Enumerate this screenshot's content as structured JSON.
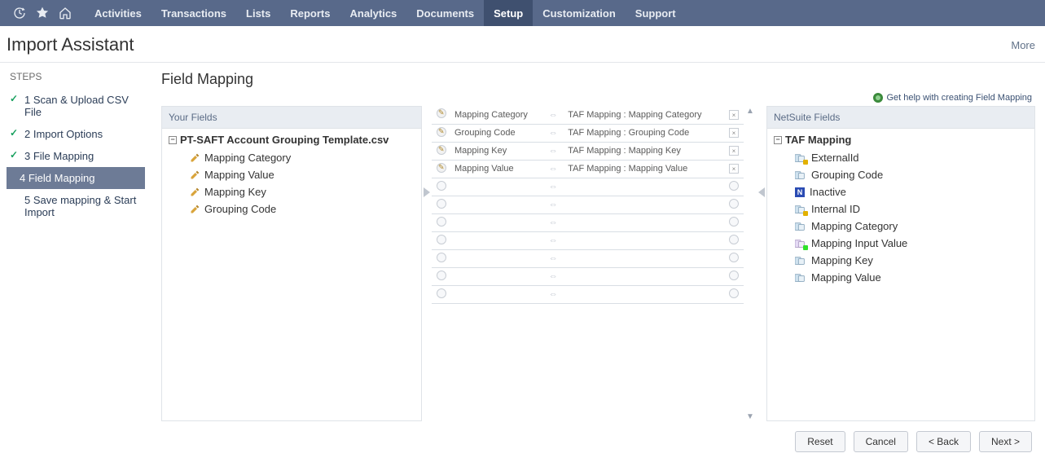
{
  "topnav": {
    "items": [
      "Activities",
      "Transactions",
      "Lists",
      "Reports",
      "Analytics",
      "Documents",
      "Setup",
      "Customization",
      "Support"
    ],
    "active_index": 6
  },
  "page": {
    "title": "Import Assistant",
    "more": "More"
  },
  "steps": {
    "title": "STEPS",
    "items": [
      {
        "num": "1",
        "label": "Scan & Upload CSV File",
        "done": true
      },
      {
        "num": "2",
        "label": "Import Options",
        "done": true
      },
      {
        "num": "3",
        "label": "File Mapping",
        "done": true
      },
      {
        "num": "4",
        "label": "Field Mapping",
        "active": true
      },
      {
        "num": "5",
        "label": "Save mapping & Start Import"
      }
    ]
  },
  "main": {
    "section_title": "Field Mapping",
    "help_text": "Get help with creating Field Mapping",
    "your_fields": {
      "header": "Your Fields",
      "root": "PT-SAFT Account Grouping Template.csv",
      "children": [
        "Mapping Category",
        "Mapping Value",
        "Mapping Key",
        "Grouping Code"
      ]
    },
    "mappings": [
      {
        "left": "Mapping Category",
        "right": "TAF Mapping : Mapping Category",
        "icon": "pencil",
        "del": true
      },
      {
        "left": "Grouping Code",
        "right": "TAF Mapping : Grouping Code",
        "icon": "pencil",
        "del": true
      },
      {
        "left": "Mapping Key",
        "right": "TAF Mapping : Mapping Key",
        "icon": "pencil",
        "del": true
      },
      {
        "left": "Mapping Value",
        "right": "TAF Mapping : Mapping Value",
        "icon": "pencil",
        "del": true
      },
      {
        "left": "",
        "right": "",
        "icon": "empty"
      },
      {
        "left": "",
        "right": "",
        "icon": "empty"
      },
      {
        "left": "",
        "right": "",
        "icon": "empty"
      },
      {
        "left": "",
        "right": "",
        "icon": "empty"
      },
      {
        "left": "",
        "right": "",
        "icon": "empty"
      },
      {
        "left": "",
        "right": "",
        "icon": "empty"
      },
      {
        "left": "",
        "right": "",
        "icon": "empty"
      }
    ],
    "netsuite_fields": {
      "header": "NetSuite Fields",
      "root": "TAF Mapping",
      "children": [
        {
          "label": "ExternalId",
          "variant": "req"
        },
        {
          "label": "Grouping Code",
          "variant": "plain"
        },
        {
          "label": "Inactive",
          "variant": "box"
        },
        {
          "label": "Internal ID",
          "variant": "req"
        },
        {
          "label": "Mapping Category",
          "variant": "plain"
        },
        {
          "label": "Mapping Input Value",
          "variant": "req-green"
        },
        {
          "label": "Mapping Key",
          "variant": "plain"
        },
        {
          "label": "Mapping Value",
          "variant": "plain"
        }
      ]
    }
  },
  "footer": {
    "reset": "Reset",
    "cancel": "Cancel",
    "back": "< Back",
    "next": "Next >"
  }
}
